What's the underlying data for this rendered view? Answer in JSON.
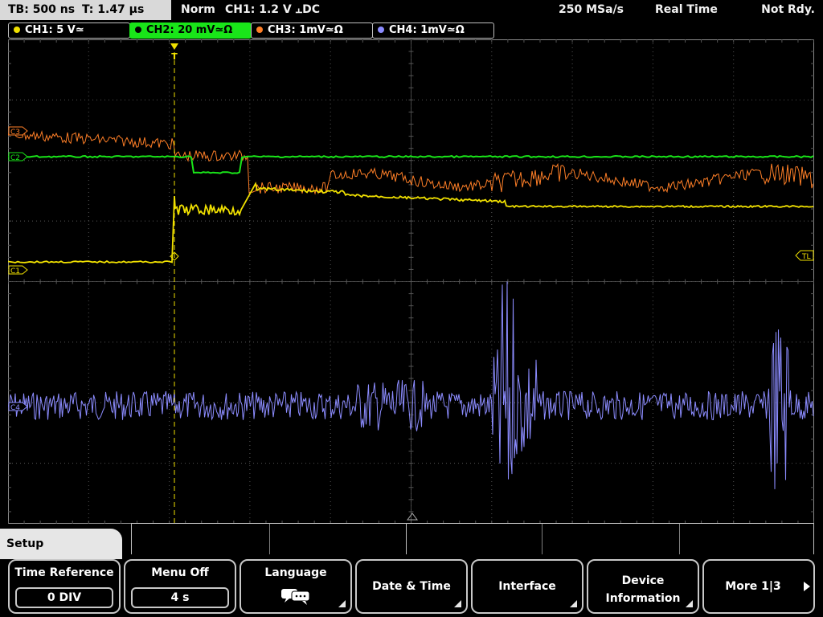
{
  "status": {
    "timebase": "TB: 500 ns",
    "trigger_time": "T: 1.47 µs",
    "mode": "Norm",
    "trigger": "CH1: 1.2 V ⫠DC",
    "sample_rate": "250 MSa/s",
    "acquisition": "Real Time",
    "state": "Not Rdy."
  },
  "channels": [
    {
      "label": "CH1: 5 V≃",
      "color": "#f0e000",
      "active": false
    },
    {
      "label": "CH2: 20 mV≃Ω",
      "color": "#19e519",
      "active": true
    },
    {
      "label": "CH3: 1mV≃Ω",
      "color": "#ff7f27",
      "active": false
    },
    {
      "label": "CH4: 1mV≃Ω",
      "color": "#8c8cff",
      "active": false
    }
  ],
  "markers": {
    "c3": "C3",
    "c2": "C2",
    "c1": "C1",
    "c4": "C4",
    "trigger_level": "TL",
    "trigger_pos": "T"
  },
  "menu": {
    "title": "Setup",
    "softkeys": [
      {
        "label": "Time Reference",
        "value": "0 DIV"
      },
      {
        "label": "Menu Off",
        "value": "4 s"
      },
      {
        "label": "Language",
        "icon": "speech-bubbles-icon"
      },
      {
        "label": "Date & Time"
      },
      {
        "label": "Interface"
      },
      {
        "label_line1": "Device",
        "label_line2": "Information"
      },
      {
        "label": "More 1|3"
      }
    ]
  },
  "colors": {
    "ch1": "#f0e000",
    "ch2": "#19e519",
    "ch3": "#ff7f27",
    "ch4": "#8c8cff",
    "grid": "#555555"
  }
}
